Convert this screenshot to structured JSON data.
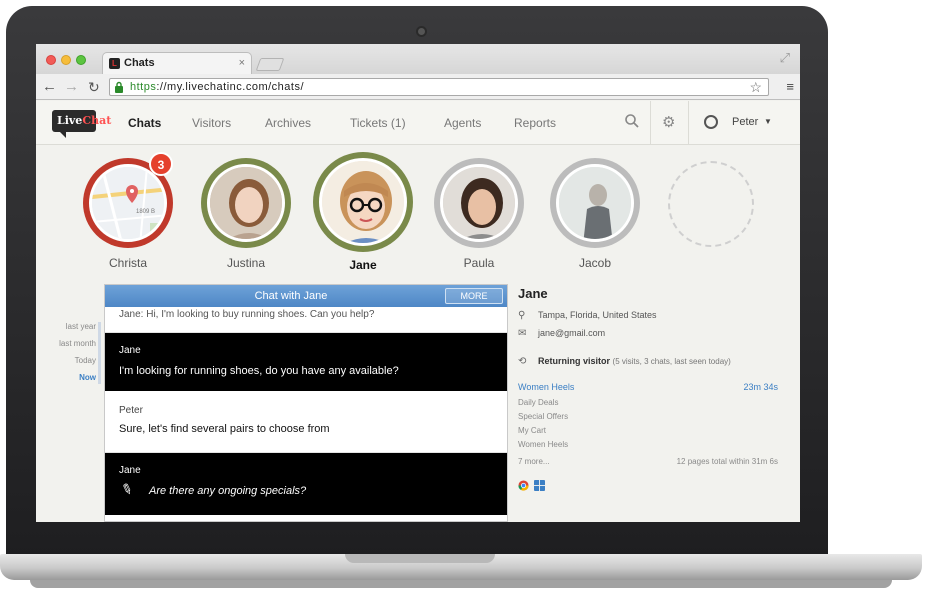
{
  "browser": {
    "tab_title": "Chats",
    "tab_close": "×",
    "url_protocol": "https",
    "url_rest": "://my.livechatinc.com/chats/",
    "back": "←",
    "forward": "→",
    "reload": "↻",
    "star": "☆",
    "menu": "≡",
    "expand": "⤢"
  },
  "app": {
    "logo_part1": "Live",
    "logo_part2": "Chat",
    "nav": [
      {
        "label": "Chats",
        "active": true
      },
      {
        "label": "Visitors"
      },
      {
        "label": "Archives"
      },
      {
        "label": "Tickets (1)"
      },
      {
        "label": "Agents"
      },
      {
        "label": "Reports"
      }
    ],
    "gear": "⚙",
    "user_name": "Peter",
    "caret": "▼"
  },
  "visitors": [
    {
      "name": "Christa",
      "type": "map",
      "ring_color": "#c0392b",
      "badge": "3",
      "map_label": "1809 B"
    },
    {
      "name": "Justina",
      "ring_color": "#7a8a4a"
    },
    {
      "name": "Jane",
      "ring_color": "#7a8a4a",
      "active": true
    },
    {
      "name": "Paula",
      "ring_color": "#bcbcbc"
    },
    {
      "name": "Jacob",
      "ring_color": "#bcbcbc"
    }
  ],
  "timeline": [
    "last year",
    "last month",
    "Today",
    "Now"
  ],
  "chat": {
    "title": "Chat with Jane",
    "more_label": "MORE",
    "partial_text": "Jane: Hi, I'm looking to buy running shoes. Can you help?",
    "messages": [
      {
        "author": "Jane",
        "text": "I'm looking for running shoes, do you have any available?",
        "dark": true
      },
      {
        "author": "Peter",
        "text": "Sure, let's find several pairs to choose from",
        "dark": false
      },
      {
        "author": "Jane",
        "text": "Are there any ongoing specials?",
        "dark": true,
        "typing": true
      }
    ],
    "pencil": "✎"
  },
  "details": {
    "name": "Jane",
    "location": "Tampa, Florida, United States",
    "email": "jane@gmail.com",
    "returning_label": "Returning visitor",
    "returning_sub": "(5 visits, 3 chats, last seen today)",
    "pages": [
      {
        "title": "Women Heels",
        "time": "23m 34s"
      },
      {
        "title": "Daily Deals"
      },
      {
        "title": "Special Offers"
      },
      {
        "title": "My Cart"
      },
      {
        "title": "Women Heels"
      },
      {
        "title": "7 more...",
        "time": "12 pages total within 31m 6s"
      }
    ],
    "location_icon": "⚲",
    "email_icon": "✉",
    "returning_icon": "⟲"
  }
}
